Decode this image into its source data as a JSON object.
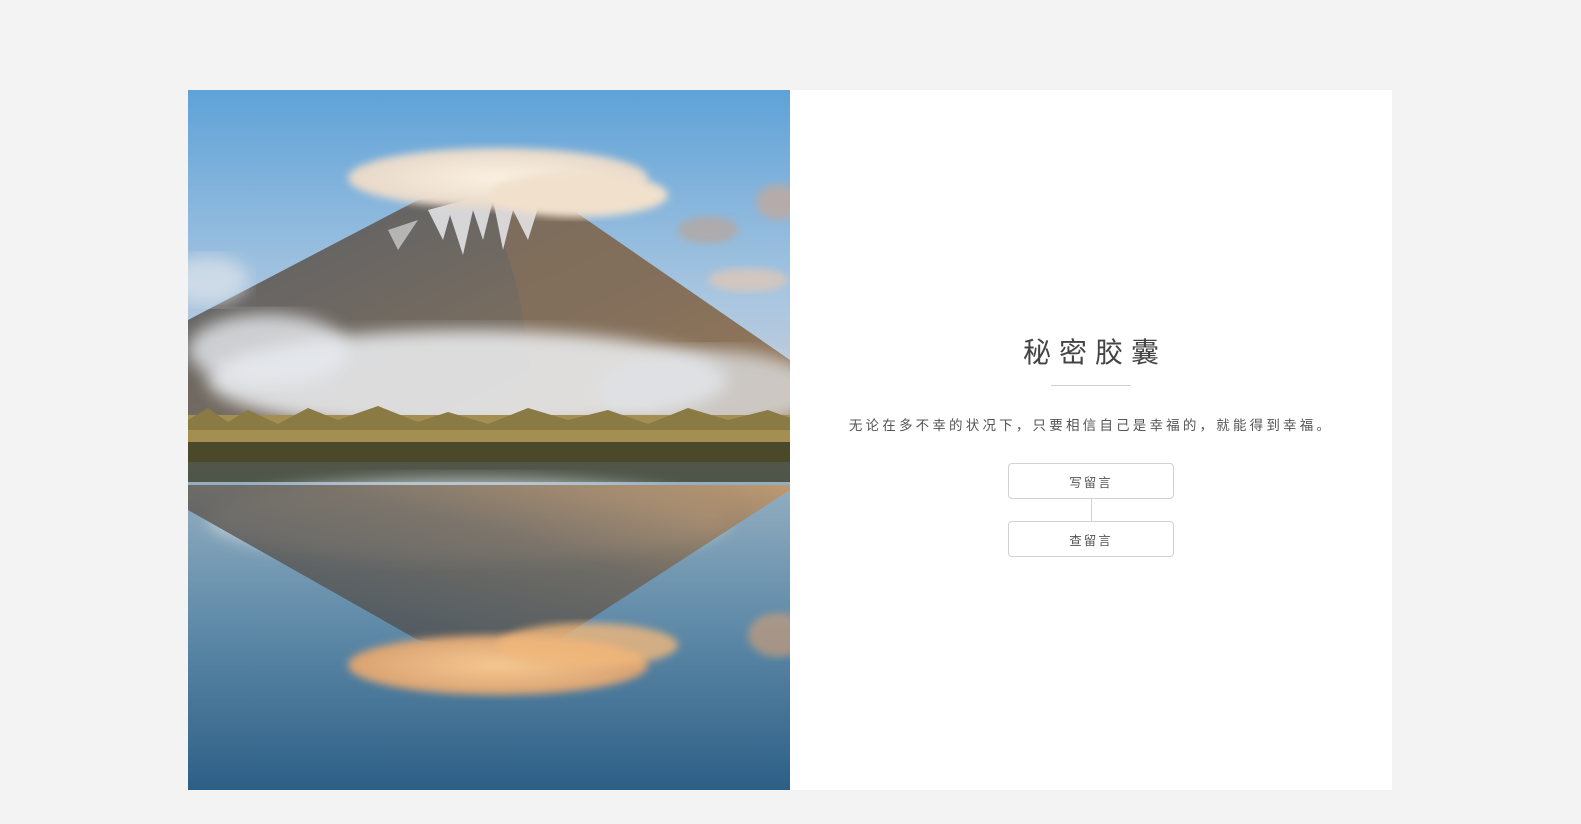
{
  "capsule": {
    "title": "秘密胶囊",
    "quote": "无论在多不幸的状况下，只要相信自己是幸福的，就能得到幸福。",
    "write_button_label": "写留言",
    "view_button_label": "查留言"
  },
  "colors": {
    "page_background": "#f3f3f3",
    "card_background": "#ffffff",
    "text": "#444444",
    "button_border": "#d2d2d2"
  }
}
